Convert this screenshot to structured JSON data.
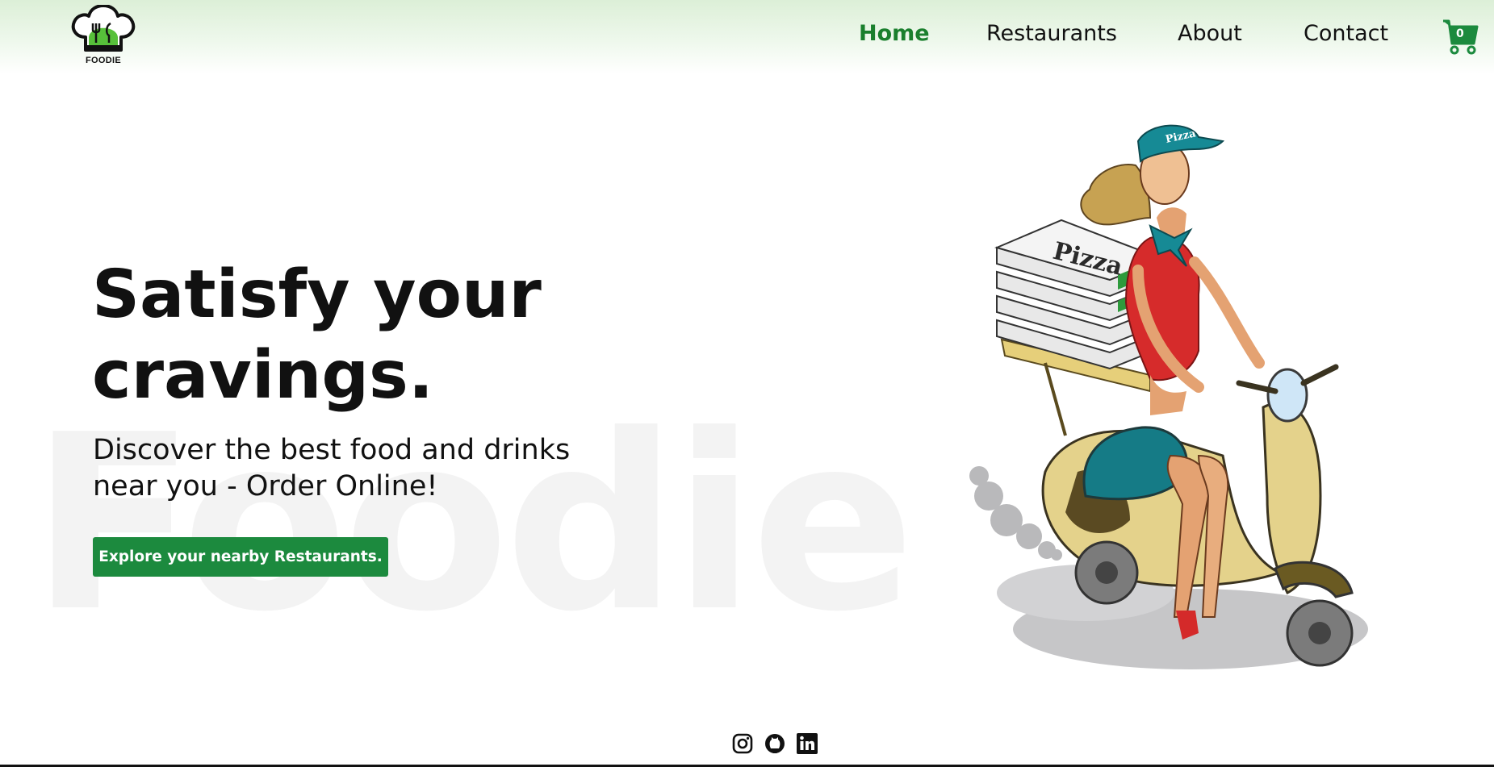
{
  "logo": {
    "text": "FOODIE",
    "icon": "chef-hat-logo-icon"
  },
  "nav": {
    "links": [
      {
        "label": "Home",
        "active": true
      },
      {
        "label": "Restaurants",
        "active": false
      },
      {
        "label": "About",
        "active": false
      },
      {
        "label": "Contact",
        "active": false
      }
    ],
    "cart": {
      "count": "0",
      "icon": "shopping-cart-icon"
    }
  },
  "hero": {
    "watermark": "Foodie",
    "title": "Satisfy your cravings.",
    "subtitle": "Discover the best food and drinks near you - Order Online!",
    "cta_label": "Explore your nearby Restaurants.",
    "illustration": {
      "box_text": "Pizza",
      "cap_text": "Pizza"
    }
  },
  "footer": {
    "social_icons": [
      "instagram-icon",
      "github-icon",
      "linkedin-icon"
    ]
  },
  "colors": {
    "accent": "#1a7f2d",
    "button": "#1c8a3e",
    "nav_gradient_top": "#dcefd7"
  }
}
